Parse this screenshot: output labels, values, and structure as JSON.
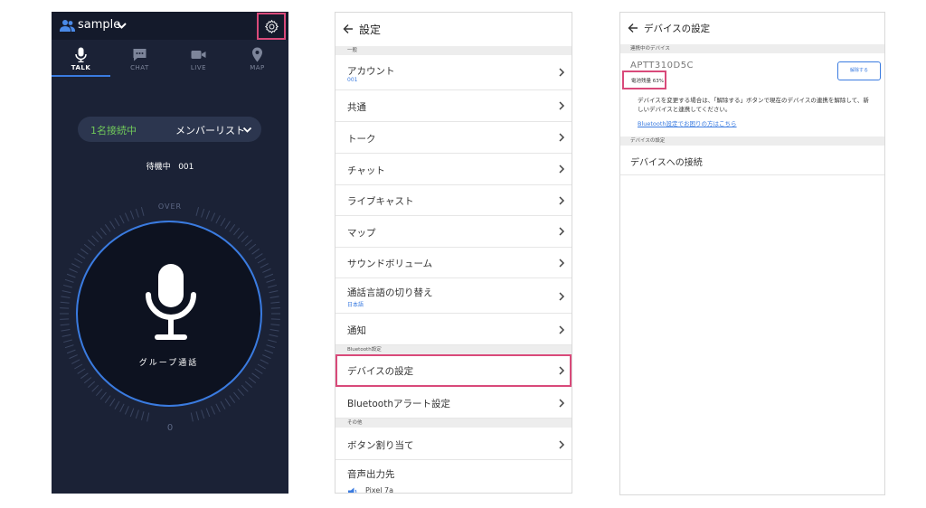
{
  "talk": {
    "group_name": "sample",
    "tabs": [
      {
        "label": "TALK",
        "icon": "mic-icon"
      },
      {
        "label": "CHAT",
        "icon": "chat-icon"
      },
      {
        "label": "LIVE",
        "icon": "video-icon"
      },
      {
        "label": "MAP",
        "icon": "map-pin-icon"
      }
    ],
    "connected_count": "1名接続中",
    "member_list_label": "メンバーリスト",
    "status_label": "待機中",
    "status_id": "001",
    "over_label": "OVER",
    "ptt_label": "グループ通話",
    "counter": "0"
  },
  "settings": {
    "title": "設定",
    "sections": {
      "general": "一般",
      "bluetooth": "Bluetooth設定",
      "other": "その他"
    },
    "items": {
      "account": "アカウント",
      "account_sub": "001",
      "common": "共通",
      "talk": "トーク",
      "chat": "チャット",
      "livecast": "ライブキャスト",
      "map": "マップ",
      "sound_volume": "サウンドボリューム",
      "language": "通話言語の切り替え",
      "language_sub": "日本語",
      "notification": "通知",
      "device_settings": "デバイスの設定",
      "bt_alert": "Bluetoothアラート設定",
      "button_assign": "ボタン割り当て",
      "audio_output": "音声出力先",
      "audio_output_device": "Pixel 7a"
    }
  },
  "device": {
    "title": "デバイスの設定",
    "section_connected": "連携中のデバイス",
    "device_name": "APTT310D5C",
    "battery": "電池残量 63%",
    "unpair_button": "解除する",
    "description": "デバイスを変更する場合は、「解除する」ボタンで現在のデバイスの連携を解除して、新しいデバイスと連携してください。",
    "help_link": "Bluetooth設定でお困りの方はこちら",
    "section_settings": "デバイスの設定",
    "connect_row": "デバイスへの接続"
  },
  "colors": {
    "dark_bg": "#1b2236",
    "accent_blue": "#3a7be0",
    "highlight": "#d94a7a",
    "connected_green": "#70c85a"
  }
}
